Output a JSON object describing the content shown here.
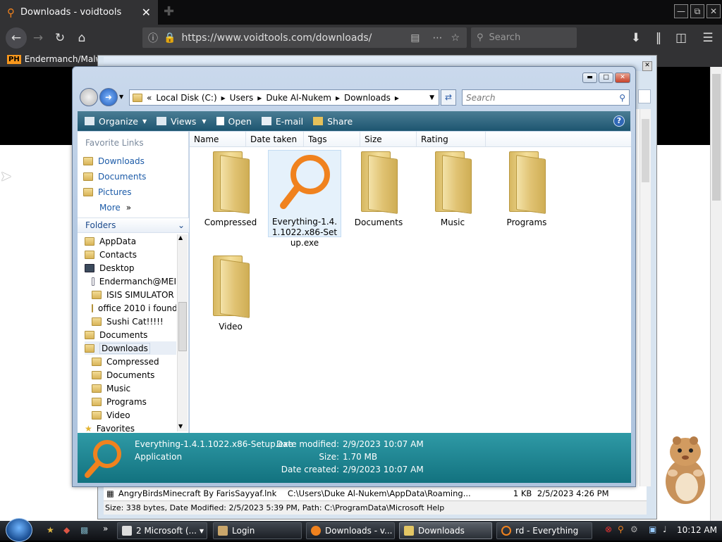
{
  "firefox": {
    "tab_title": "Downloads - voidtools",
    "url": "https://www.voidtools.com/downloads/",
    "search_placeholder": "Search",
    "bookmark": "Endermanch/Malwa",
    "bookmark_logo": "PH"
  },
  "everything": {
    "title": "rd - Everything",
    "row": {
      "name": "AngryBirdsMinecraft By FarisSayyaf.lnk",
      "path": "C:\\Users\\Duke Al-Nukem\\AppData\\Roaming...",
      "size": "1 KB",
      "date": "2/5/2023 4:26 PM"
    },
    "status": "Size: 338 bytes, Date Modified: 2/5/2023 5:39 PM, Path: C:\\ProgramData\\Microsoft Help"
  },
  "explorer": {
    "address": [
      "Local Disk (C:)",
      "Users",
      "Duke Al-Nukem",
      "Downloads"
    ],
    "search_placeholder": "Search",
    "toolbar": {
      "organize": "Organize",
      "views": "Views",
      "open": "Open",
      "email": "E-mail",
      "share": "Share",
      "help": "?"
    },
    "favorite_links_title": "Favorite Links",
    "favorite_links": [
      "Downloads",
      "Documents",
      "Pictures",
      "More"
    ],
    "folders_title": "Folders",
    "tree": [
      "AppData",
      "Contacts",
      "Desktop",
      "Endermanch@MEI",
      "ISIS SIMULATOR",
      "office 2010 i found",
      "Sushi Cat!!!!!",
      "Documents",
      "Downloads",
      "Compressed",
      "Documents",
      "Music",
      "Programs",
      "Video",
      "Favorites"
    ],
    "columns": [
      "Name",
      "Date taken",
      "Tags",
      "Size",
      "Rating"
    ],
    "items": [
      "Compressed",
      "Everything-1.4.1.1022.x86-Setup.exe",
      "Documents",
      "Music",
      "Programs",
      "Video"
    ],
    "details": {
      "name": "Everything-1.4.1.1022.x86-Setup.exe",
      "type": "Application",
      "modified_label": "Date modified:",
      "modified": "2/9/2023 10:07 AM",
      "size_label": "Size:",
      "size": "1.70 MB",
      "created_label": "Date created:",
      "created": "2/9/2023 10:07 AM"
    }
  },
  "taskbar": {
    "items": [
      "2 Microsoft (...",
      "Login",
      "Downloads - v...",
      "Downloads",
      "rd - Everything"
    ],
    "clock": "10:12 AM"
  },
  "colors": {
    "accent": "#f0821e",
    "toolbar": "#1d5570",
    "details": "#12727f"
  }
}
